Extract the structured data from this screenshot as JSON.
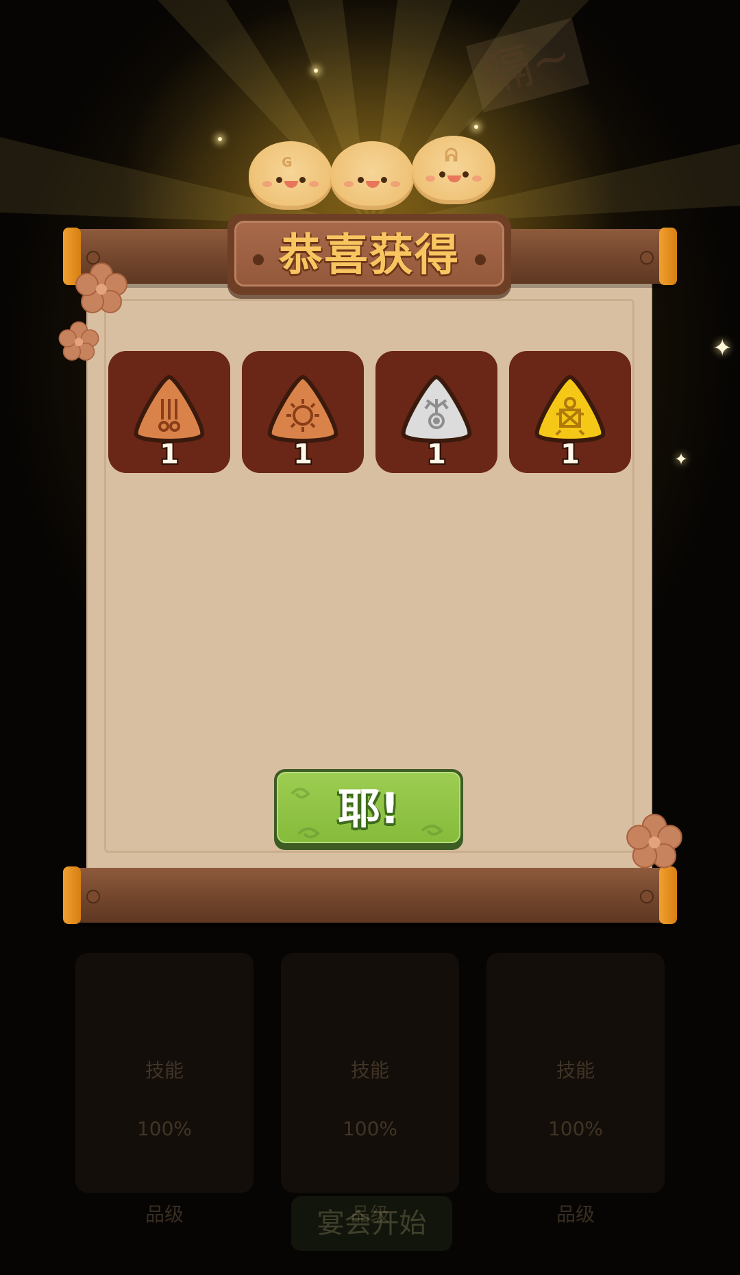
{
  "reward_dialog": {
    "title": "恭喜获得",
    "confirm_label": "耶!",
    "items": [
      {
        "icon": "copper-triangle-icon",
        "color": "#d9834a",
        "count": "1"
      },
      {
        "icon": "copper-sun-triangle-icon",
        "color": "#d9834a",
        "count": "1"
      },
      {
        "icon": "silver-triangle-icon",
        "color": "#dcdcdc",
        "count": "1"
      },
      {
        "icon": "gold-triangle-icon",
        "color": "#f5c817",
        "count": "1"
      }
    ]
  },
  "background": {
    "sign_text": "嗝~",
    "cards": [
      {
        "skill_label": "技能",
        "percent": "100%",
        "level_label": "品级"
      },
      {
        "skill_label": "技能",
        "percent": "100%",
        "level_label": "品级"
      },
      {
        "skill_label": "技能",
        "percent": "100%",
        "level_label": "品级"
      }
    ],
    "start_label": "宴会开始"
  },
  "colors": {
    "button_green": "#8cc142",
    "title_gold": "#f8c561",
    "paper": "#d8bfa2",
    "wood": "#70442b"
  }
}
